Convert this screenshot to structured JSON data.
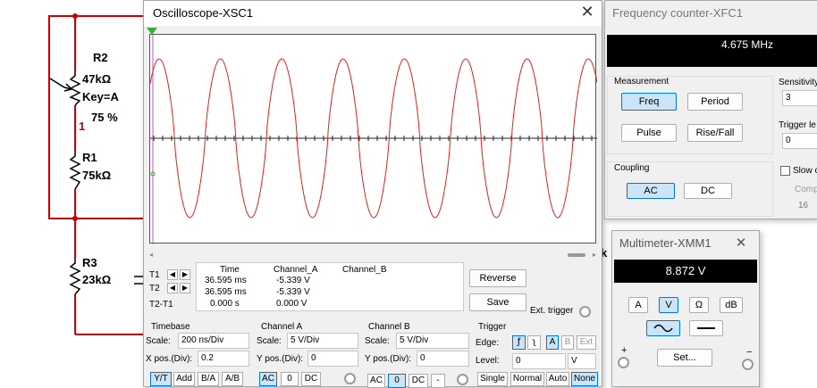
{
  "schematic": {
    "r2_name": "R2",
    "r2_value": "47kΩ",
    "r2_key": "Key=A",
    "r2_percent": "75 %",
    "node": "1",
    "r1_name": "R1",
    "r1_value": "75kΩ",
    "r3_name": "R3",
    "r3_value": "23kΩ",
    "partial_label": "k",
    "wire_color": "#cc0000"
  },
  "oscilloscope": {
    "title": "Oscilloscope-XSC1",
    "close": "✕",
    "trace_color": "#e02020",
    "measure": {
      "headers": [
        "Time",
        "Channel_A",
        "Channel_B"
      ],
      "rows": [
        {
          "label": "T1",
          "time": "36.595 ms",
          "a": "-5.339 V",
          "b": ""
        },
        {
          "label": "T2",
          "time": "36.595 ms",
          "a": "-5.339 V",
          "b": ""
        },
        {
          "label": "T2-T1",
          "time": "0.000 s",
          "a": "0.000 V",
          "b": ""
        }
      ]
    },
    "reverse": "Reverse",
    "save": "Save",
    "ext_trigger": "Ext. trigger",
    "timebase": {
      "title": "Timebase",
      "scale_label": "Scale:",
      "scale": "200 ns/Div",
      "xpos_label": "X pos.(Div):",
      "xpos": "0.2",
      "modes": [
        "Y/T",
        "Add",
        "B/A",
        "A/B"
      ]
    },
    "channel_a": {
      "title": "Channel A",
      "scale_label": "Scale:",
      "scale": "5  V/Div",
      "ypos_label": "Y pos.(Div):",
      "ypos": "0",
      "coupling": [
        "AC",
        "0",
        "DC"
      ]
    },
    "channel_b": {
      "title": "Channel B",
      "scale_label": "Scale:",
      "scale": "5  V/Div",
      "ypos_label": "Y pos.(Div):",
      "ypos": "0",
      "coupling": [
        "AC",
        "0",
        "DC",
        "-"
      ]
    },
    "trigger": {
      "title": "Trigger",
      "edge_label": "Edge:",
      "edges": [
        "∱",
        "∲"
      ],
      "sources": [
        "A",
        "B",
        "Ext"
      ],
      "level_label": "Level:",
      "level": "0",
      "level_unit": "V",
      "modes": [
        "Single",
        "Normal",
        "Auto",
        "None"
      ]
    }
  },
  "freq_counter": {
    "title": "Frequency counter-XFC1",
    "display": "4.675 MHz",
    "measurement": {
      "title": "Measurement",
      "buttons": [
        "Freq",
        "Period",
        "Pulse",
        "Rise/Fall"
      ]
    },
    "coupling": {
      "title": "Coupling",
      "buttons": [
        "AC",
        "DC"
      ]
    },
    "sensitivity": {
      "title": "Sensitivity",
      "value": "3"
    },
    "trigger_level": {
      "title": "Trigger le",
      "value": "0"
    },
    "slow": {
      "label": "Slow c"
    },
    "comp": {
      "label": "Comp",
      "value": "16"
    }
  },
  "multimeter": {
    "title": "Multimeter-XMM1",
    "close": "✕",
    "display": "8.872 V",
    "modes": [
      "A",
      "V",
      "Ω",
      "dB"
    ],
    "set": "Set...",
    "plus": "+",
    "minus": "−"
  }
}
